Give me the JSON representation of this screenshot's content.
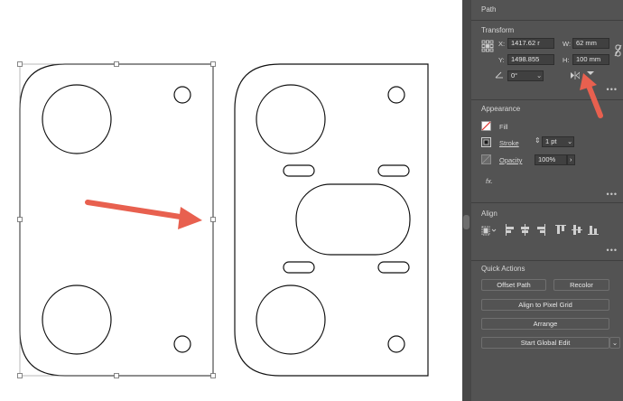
{
  "panel": {
    "title": "Path",
    "transform": {
      "title": "Transform",
      "x_label": "X:",
      "x_value": "1417.62 r",
      "y_label": "Y:",
      "y_value": "1498.855",
      "w_label": "W:",
      "w_value": "62 mm",
      "h_label": "H:",
      "h_value": "100 mm",
      "angle_value": "0°"
    },
    "appearance": {
      "title": "Appearance",
      "fill_label": "Fill",
      "stroke_label": "Stroke",
      "stroke_value": "1 pt",
      "opacity_label": "Opacity",
      "opacity_value": "100%",
      "fx_label": "fx."
    },
    "align": {
      "title": "Align"
    },
    "quick_actions": {
      "title": "Quick Actions",
      "offset_path": "Offset Path",
      "recolor": "Recolor",
      "align_pixel_grid": "Align to Pixel Grid",
      "arrange": "Arrange",
      "start_global_edit": "Start Global Edit"
    }
  },
  "colors": {
    "annotation_arrow": "#e8604f",
    "panel_bg": "#535353",
    "field_bg": "#404040"
  }
}
